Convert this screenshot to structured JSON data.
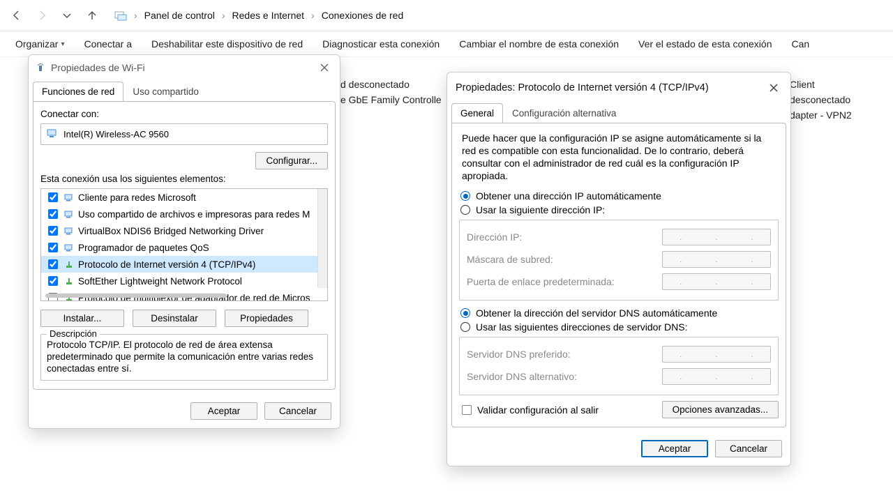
{
  "nav": {
    "breadcrumb": [
      "Panel de control",
      "Redes e Internet",
      "Conexiones de red"
    ]
  },
  "commands": {
    "organize": "Organizar",
    "connect": "Conectar a",
    "disable": "Deshabilitar este dispositivo de red",
    "diagnose": "Diagnosticar esta conexión",
    "rename": "Cambiar el nombre de esta conexión",
    "status": "Ver el estado de esta conexión",
    "more": "Can"
  },
  "bg": {
    "col1_line1": "d desconectado",
    "col1_line2": "e GbE Family Controlle",
    "col2_line0": "Client",
    "col2_line1": "desconectado",
    "col2_line2": "dapter - VPN2"
  },
  "wifi_dialog": {
    "title": "Propiedades de Wi-Fi",
    "tab_net": "Funciones de red",
    "tab_share": "Uso compartido",
    "connect_with": "Conectar con:",
    "adapter_name": "Intel(R) Wireless-AC 9560",
    "configure": "Configurar...",
    "elements_label": "Esta conexión usa los siguientes elementos:",
    "items": [
      {
        "label": "Cliente para redes Microsoft",
        "checked": true
      },
      {
        "label": "Uso compartido de archivos e impresoras para redes M",
        "checked": true
      },
      {
        "label": "VirtualBox NDIS6 Bridged Networking Driver",
        "checked": true
      },
      {
        "label": "Programador de paquetes QoS",
        "checked": true
      },
      {
        "label": "Protocolo de Internet versión 4 (TCP/IPv4)",
        "checked": true,
        "selected": true
      },
      {
        "label": "SoftEther Lightweight Network Protocol",
        "checked": true
      },
      {
        "label": "Protocolo de multiplexor de adaptador de red de Micros",
        "checked": false
      }
    ],
    "install": "Instalar...",
    "uninstall": "Desinstalar",
    "properties": "Propiedades",
    "desc_title": "Descripción",
    "desc_text": "Protocolo TCP/IP. El protocolo de red de área extensa predeterminado que permite la comunicación entre varias redes conectadas entre sí.",
    "ok": "Aceptar",
    "cancel": "Cancelar"
  },
  "ipv4_dialog": {
    "title": "Propiedades: Protocolo de Internet versión 4 (TCP/IPv4)",
    "tab_general": "General",
    "tab_alt": "Configuración alternativa",
    "intro": "Puede hacer que la configuración IP se asigne automáticamente si la red es compatible con esta funcionalidad. De lo contrario, deberá consultar con el administrador de red cuál es la configuración IP apropiada.",
    "ip_auto": "Obtener una dirección IP automáticamente",
    "ip_manual": "Usar la siguiente dirección IP:",
    "ip_addr": "Dirección IP:",
    "ip_mask": "Máscara de subred:",
    "ip_gw": "Puerta de enlace predeterminada:",
    "dns_auto": "Obtener la dirección del servidor DNS automáticamente",
    "dns_manual": "Usar las siguientes direcciones de servidor DNS:",
    "dns_pref": "Servidor DNS preferido:",
    "dns_alt": "Servidor DNS alternativo:",
    "validate": "Validar configuración al salir",
    "advanced": "Opciones avanzadas...",
    "ok": "Aceptar",
    "cancel": "Cancelar"
  }
}
